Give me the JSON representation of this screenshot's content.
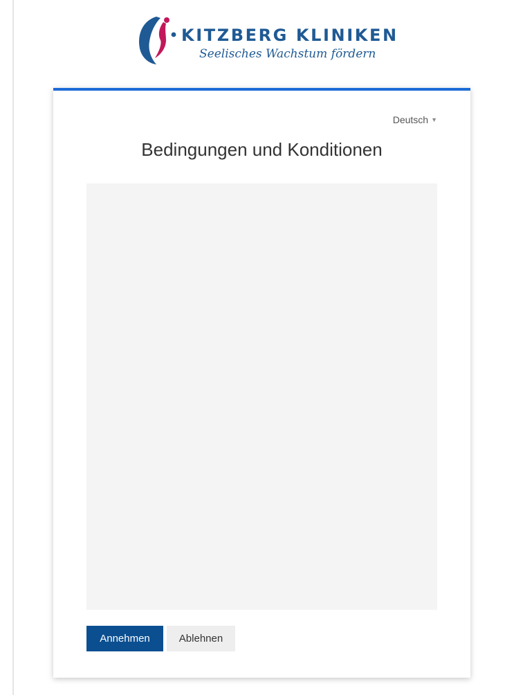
{
  "brand": {
    "name": "KITZBERG KLINIKEN",
    "tagline": "Seelisches Wachstum fördern",
    "colors": {
      "primary_blue": "#1f5a94",
      "magenta": "#c2185b",
      "accent_blue": "#1d6bd6",
      "button_blue": "#0b4f91"
    },
    "logo_icon": "kitzberg-figure-logo"
  },
  "language": {
    "selected": "Deutsch",
    "caret_icon": "chevron-down-icon"
  },
  "terms": {
    "title": "Bedingungen und Konditionen"
  },
  "actions": {
    "accept_label": "Annehmen",
    "decline_label": "Ablehnen"
  }
}
